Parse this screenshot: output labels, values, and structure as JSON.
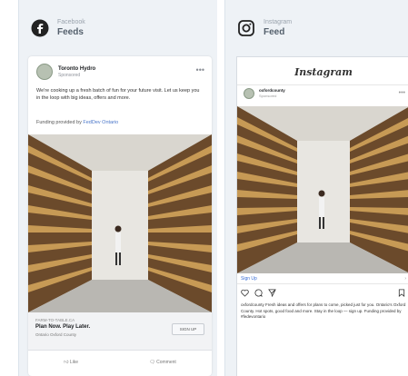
{
  "facebook_panel": {
    "network": "Facebook",
    "placement": "Feeds",
    "card": {
      "page_name": "Toronto Hydro",
      "sponsored": "Sponsored",
      "post_text": "We're cooking up a fresh batch of fun for your future visit. Let us keep you in the loop with big ideas, offers and more.",
      "funding_prefix": "Funding provided by",
      "funding_source": "FedDev Ontario",
      "link_url": "FARM-TO-TABLE.CA",
      "link_headline": "Plan Now. Play Later.",
      "link_description": "Ontario Oxford County",
      "cta": "SIGN UP",
      "actions": [
        "Like",
        "Comment"
      ]
    }
  },
  "instagram_panel": {
    "network": "Instagram",
    "placement": "Feed",
    "card": {
      "app_logo": "Instagram",
      "account": "oxfordcounty",
      "sponsored": "Sponsored",
      "signup": "Sign Up",
      "caption": "oxfordcounty Fresh ideas and offers for plans to come, picked just for you. Ontario's Oxford County. Hot spots, good food and more. Stay in the loop — sign up. Funding provided by #fedevontario"
    }
  },
  "colors": {
    "panel_bg": "#eef2f6",
    "link_blue": "#3a6fd6",
    "shelf_wood": "#b58a4e"
  },
  "icons": [
    "facebook-logo-icon",
    "instagram-logo-icon",
    "more-icon",
    "heart-icon",
    "comment-icon",
    "share-icon",
    "bookmark-icon",
    "like-icon"
  ]
}
